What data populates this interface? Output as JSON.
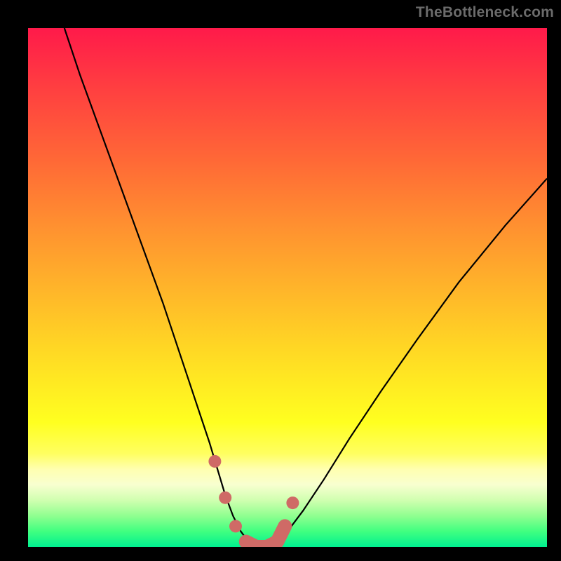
{
  "watermark": "TheBottleneck.com",
  "colors": {
    "frame": "#000000",
    "curve": "#000000",
    "marker": "#cf6a66",
    "gradient_top": "#ff1a4a",
    "gradient_bottom": "#00f090"
  },
  "chart_data": {
    "type": "line",
    "title": "",
    "xlabel": "",
    "ylabel": "",
    "xlim": [
      0,
      100
    ],
    "ylim": [
      0,
      100
    ],
    "grid": false,
    "series": [
      {
        "name": "bottleneck-curve",
        "x": [
          7,
          10,
          14,
          18,
          22,
          26,
          29,
          31,
          33,
          35,
          36.5,
          38,
          39.5,
          41,
          42.5,
          44,
          46,
          48,
          50,
          53,
          57,
          62,
          68,
          75,
          83,
          92,
          100
        ],
        "y": [
          100,
          91,
          80,
          69,
          58,
          47,
          38,
          32,
          26,
          20,
          15,
          10,
          6,
          3,
          1,
          0,
          0,
          1,
          3,
          7,
          13,
          21,
          30,
          40,
          51,
          62,
          71
        ]
      }
    ],
    "annotations": [
      {
        "name": "sweet-spot-markers",
        "x": [
          36.0,
          38.0,
          40.0,
          42.0,
          44.0,
          46.0,
          48.0,
          49.5,
          51.0
        ],
        "y": [
          16.5,
          9.5,
          4.0,
          1.0,
          0.0,
          0.0,
          1.0,
          4.0,
          8.5
        ]
      }
    ]
  }
}
